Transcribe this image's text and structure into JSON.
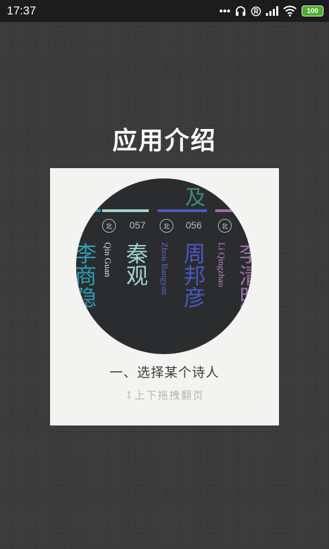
{
  "status_bar": {
    "time": "17:37",
    "battery": "100",
    "icons": [
      "more-dots-icon",
      "headset-icon",
      "registered-icon",
      "signal-icon",
      "wifi-icon",
      "battery-icon"
    ]
  },
  "title": "应用介绍",
  "card": {
    "preview": {
      "top_partial_char": "及",
      "poets": [
        {
          "name": "李商隐",
          "pinyin": "",
          "number": "",
          "region": "",
          "color": "#2f9bb3"
        },
        {
          "name": "秦观",
          "pinyin": "Qin Guan",
          "number": "057",
          "region": "北",
          "color": "#9fd3cf"
        },
        {
          "name": "周邦彦",
          "pinyin": "Zhou Bangyan",
          "number": "056",
          "region": "北",
          "color": "#4a58c0"
        },
        {
          "name": "李清照",
          "pinyin": "Li Qingzhao",
          "number": "",
          "region": "北",
          "color": "#9a6fa8"
        }
      ]
    },
    "step_text": "一、选择某个诗人",
    "hint_arrow": "↕",
    "hint_text": "上下拖拽翻页"
  }
}
